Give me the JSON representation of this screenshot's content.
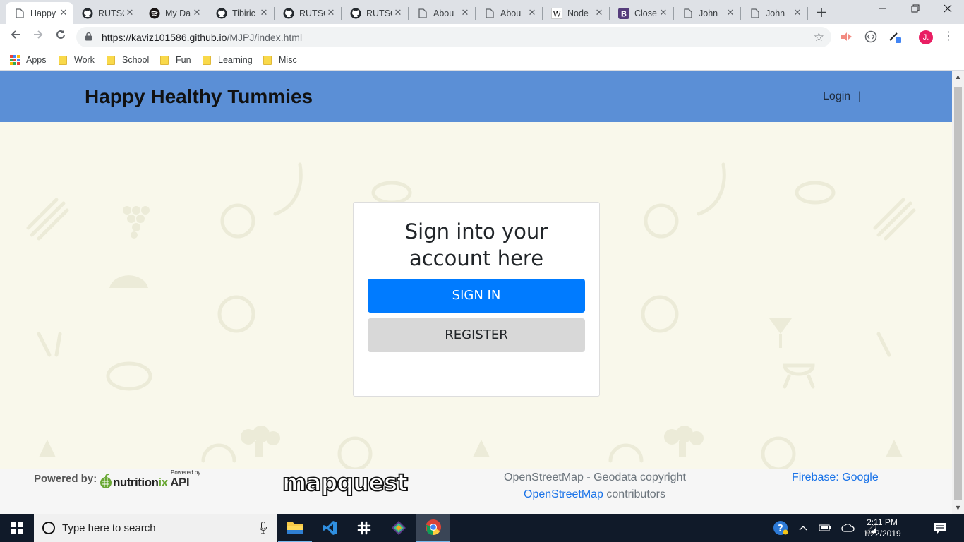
{
  "browser": {
    "tabs": [
      {
        "title": "Happy",
        "icon": "page-icon",
        "active": true
      },
      {
        "title": "RUTSC",
        "icon": "github-icon"
      },
      {
        "title": "My Da",
        "icon": "spotify-icon"
      },
      {
        "title": "Tibiric",
        "icon": "github-icon"
      },
      {
        "title": "RUTSC",
        "icon": "github-icon"
      },
      {
        "title": "RUTSC",
        "icon": "github-icon"
      },
      {
        "title": "Abou",
        "icon": "page-icon"
      },
      {
        "title": "Abou",
        "icon": "page-icon"
      },
      {
        "title": "Node",
        "icon": "wikipedia-icon"
      },
      {
        "title": "Close",
        "icon": "bootstrap-icon"
      },
      {
        "title": "John",
        "icon": "page-icon"
      },
      {
        "title": "John",
        "icon": "page-icon"
      }
    ],
    "tab_close_glyph": "✕",
    "new_tab_glyph": "+",
    "address": {
      "host": "https://kaviz101586.github.io",
      "path": "/MJPJ/index.html"
    },
    "avatar_letter": "J.",
    "bookmarks": [
      {
        "label": "Apps",
        "icon": "apps-grid-icon"
      },
      {
        "label": "Work",
        "icon": "folder-icon"
      },
      {
        "label": "School",
        "icon": "folder-icon"
      },
      {
        "label": "Fun",
        "icon": "folder-icon"
      },
      {
        "label": "Learning",
        "icon": "folder-icon"
      },
      {
        "label": "Misc",
        "icon": "folder-icon"
      }
    ]
  },
  "site": {
    "brand": "Happy Healthy Tummies",
    "nav": {
      "login": "Login",
      "separator": "|"
    },
    "card": {
      "heading_line1": "Sign into your",
      "heading_line2": "account here",
      "sign_in": "SIGN IN",
      "register": "REGISTER"
    },
    "footer": {
      "powered_by": "Powered by:",
      "nutritionix_small": "Powered by",
      "nutritionix_word": "nutrition",
      "nutritionix_ix": "ix",
      "nutritionix_api": "API",
      "mapquest": "mapquest",
      "osm_line1": "OpenStreetMap - Geodata copyright",
      "osm_link": "OpenStreetMap",
      "osm_line2_rest": " contributors",
      "firebase": "Firebase: Google"
    },
    "colors": {
      "header": "#5b8fd6",
      "primary": "#007bff",
      "secondary": "#d8d8d8",
      "background": "#f9f8eb"
    }
  },
  "taskbar": {
    "search_placeholder": "Type here to search",
    "time": "2:11 PM",
    "date": "1/22/2019",
    "apps": [
      "file-explorer-icon",
      "vscode-icon",
      "slack-icon",
      "gitkraken-icon",
      "chrome-icon"
    ]
  }
}
